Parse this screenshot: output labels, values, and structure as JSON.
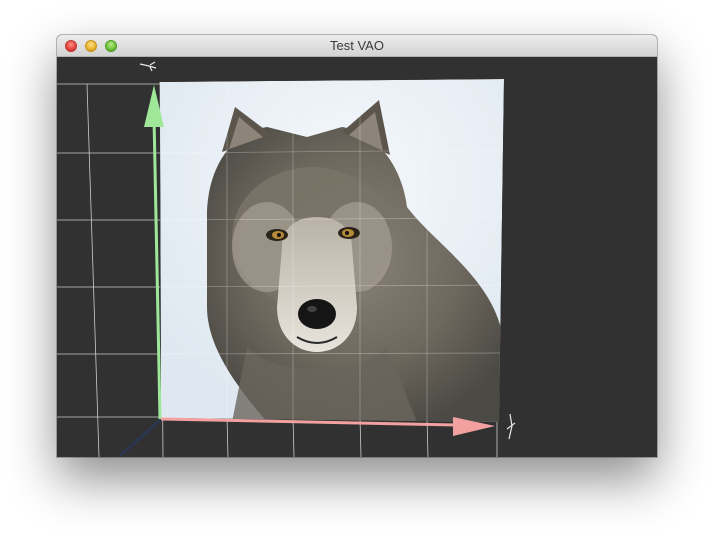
{
  "window": {
    "title": "Test VAO"
  },
  "titlebar": {
    "buttons": [
      {
        "name": "close-button",
        "color": "#e0443e"
      },
      {
        "name": "minimize-button",
        "color": "#e6b22c"
      },
      {
        "name": "zoom-button",
        "color": "#6fbf3a"
      }
    ]
  },
  "viewport": {
    "background": "#313131",
    "grid_color": "#e6e6e6",
    "textured_quad": {
      "texture": "wolf-portrait",
      "description_icon": "wolf-image"
    },
    "axes": {
      "x_color": "#f2a0a0",
      "y_color": "#9fe89a",
      "z_color": "#2b3550"
    }
  }
}
